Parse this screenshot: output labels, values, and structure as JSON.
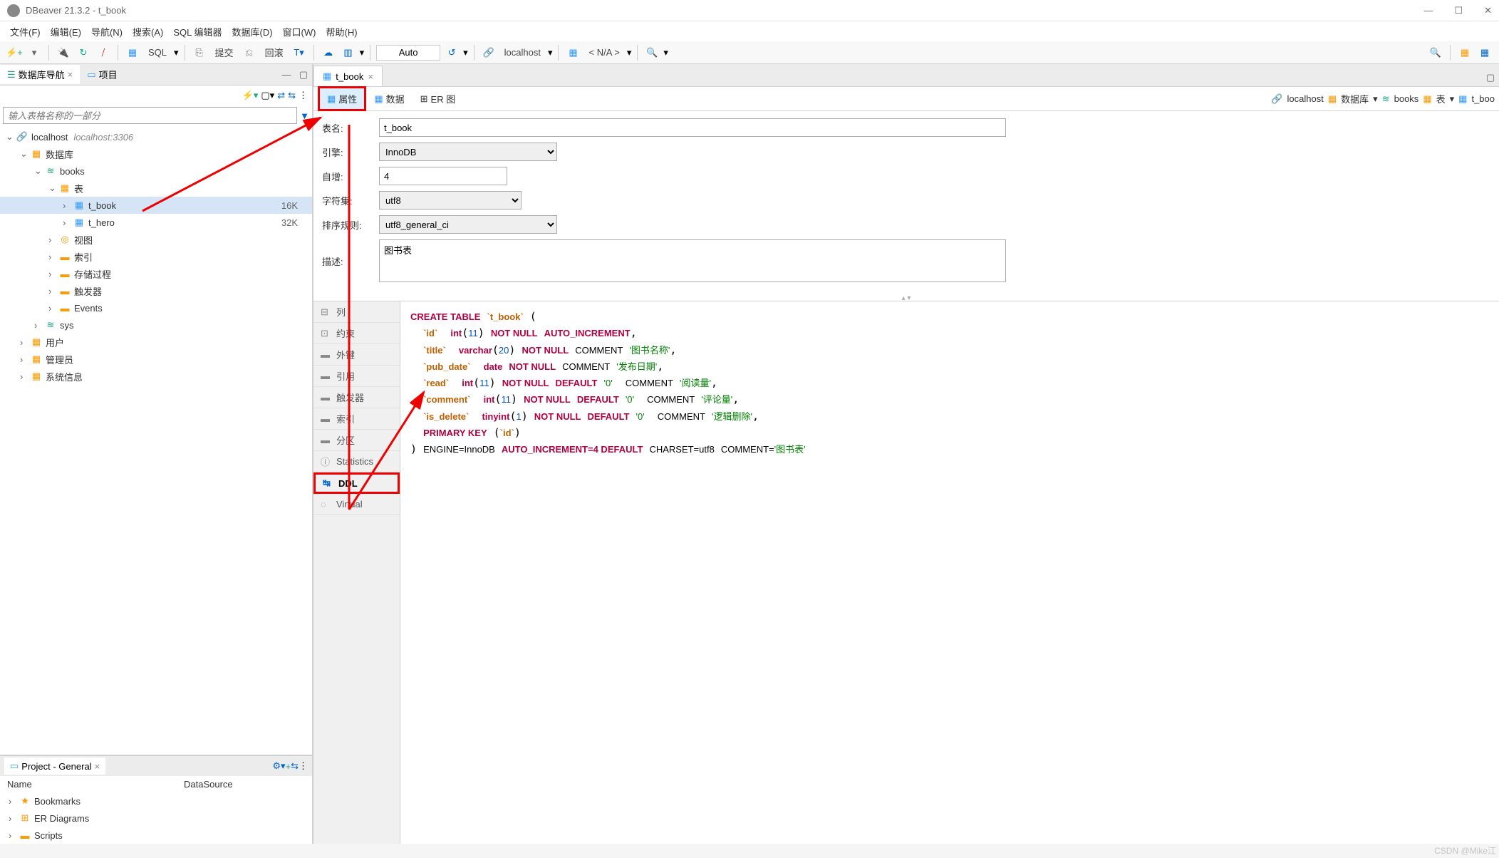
{
  "title": "DBeaver 21.3.2 - t_book",
  "menu": [
    "文件(F)",
    "编辑(E)",
    "导航(N)",
    "搜索(A)",
    "SQL 编辑器",
    "数据库(D)",
    "窗口(W)",
    "帮助(H)"
  ],
  "toolbar": {
    "sql_label": "SQL",
    "commit": "提交",
    "rollback": "回滚",
    "auto": "Auto",
    "host": "localhost",
    "na": "< N/A >"
  },
  "nav": {
    "tab1": "数据库导航",
    "tab2": "项目",
    "filter_placeholder": "输入表格名称的一部分",
    "host": "localhost",
    "host_hint": "localhost:3306",
    "db_label": "数据库",
    "books": "books",
    "table_label": "表",
    "t_book": "t_book",
    "t_book_size": "16K",
    "t_hero": "t_hero",
    "t_hero_size": "32K",
    "view": "视图",
    "index": "索引",
    "proc": "存储过程",
    "trigger": "触发器",
    "events": "Events",
    "sys": "sys",
    "users": "用户",
    "admin": "管理员",
    "sysinfo": "系统信息"
  },
  "project": {
    "title": "Project - General",
    "col_name": "Name",
    "col_ds": "DataSource",
    "bookmarks": "Bookmarks",
    "er": "ER Diagrams",
    "scripts": "Scripts"
  },
  "editor": {
    "tab": "t_book",
    "subtabs": {
      "props": "属性",
      "data": "数据",
      "er": "ER 图"
    },
    "crumbs": {
      "host": "localhost",
      "db": "数据库",
      "books": "books",
      "table": "表",
      "t_book": "t_boo"
    }
  },
  "fields": {
    "name_label": "表名:",
    "name_val": "t_book",
    "engine_label": "引擎:",
    "engine_val": "InnoDB",
    "ai_label": "自增:",
    "ai_val": "4",
    "charset_label": "字符集:",
    "charset_val": "utf8",
    "collate_label": "排序规则:",
    "collate_val": "utf8_general_ci",
    "desc_label": "描述:",
    "desc_val": "图书表"
  },
  "sidetabs": {
    "cols": "列",
    "cons": "约束",
    "fk": "外键",
    "ref": "引用",
    "trig": "触发器",
    "idx": "索引",
    "part": "分区",
    "stats": "Statistics",
    "ddl": "DDL",
    "virtual": "Virtual"
  },
  "ddl": {
    "line1_a": "CREATE TABLE",
    "line1_b": "`t_book`",
    "id": "`id`",
    "int": "int",
    "n11": "11",
    "nn": "NOT NULL",
    "ai": "AUTO_INCREMENT",
    "title": "`title`",
    "varchar": "varchar",
    "n20": "20",
    "c1": "'图书名称'",
    "pub": "`pub_date`",
    "date": "date",
    "c2": "'发布日期'",
    "read": "`read`",
    "def": "DEFAULT",
    "z": "'0'",
    "c3": "'阅读量'",
    "comment_f": "`comment`",
    "c4": "'评论量'",
    "isdel": "`is_delete`",
    "tinyint": "tinyint",
    "n1": "1",
    "c5": "'逻辑删除'",
    "pk": "PRIMARY KEY",
    "eng": "ENGINE=InnoDB",
    "ai4": "AUTO_INCREMENT=4 DEFAULT",
    "chs": "CHARSET=utf8",
    "ceq": "COMMENT=",
    "c6": "'图书表'",
    "COMMENT": "COMMENT"
  },
  "watermark": "CSDN @Mike江"
}
